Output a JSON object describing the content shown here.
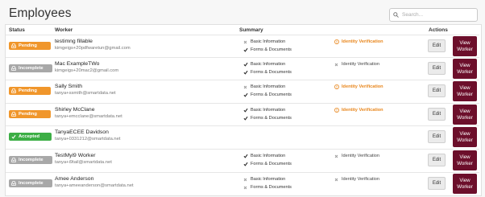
{
  "header": {
    "title": "Employees",
    "search_placeholder": "Search..."
  },
  "columns": {
    "status": "Status",
    "worker": "Worker",
    "summary": "Summary",
    "actions": "Actions"
  },
  "rows": [
    {
      "status": "Pending",
      "status_type": "pending",
      "name": "testimng fillable",
      "email": "kimgeigs+20pdfwaretun@gmail.com",
      "basic": {
        "label": "Basic Information",
        "done": false
      },
      "forms": {
        "label": "Forms & Documents",
        "done": true
      },
      "idv": {
        "label": "Identity Verification",
        "state": "warning"
      },
      "edit": "Edit",
      "view": "View Worker"
    },
    {
      "status": "Incomplete",
      "status_type": "incomplete",
      "name": "Mac ExampleTWo",
      "email": "kimgeigs+20mac2@gmail.com",
      "basic": {
        "label": "Basic Information",
        "done": true
      },
      "forms": {
        "label": "Forms & Documents",
        "done": true
      },
      "idv": {
        "label": "Identity Verification",
        "state": "incomplete"
      },
      "edit": "Edit",
      "view": "View Worker"
    },
    {
      "status": "Pending",
      "status_type": "pending",
      "name": "Sally Smith",
      "email": "tanya+ssmith@smartdata.net",
      "basic": {
        "label": "Basic Information",
        "done": false
      },
      "forms": {
        "label": "Forms & Documents",
        "done": true
      },
      "idv": {
        "label": "Identity Verification",
        "state": "warning"
      },
      "edit": "Edit",
      "view": "View Worker"
    },
    {
      "status": "Pending",
      "status_type": "pending",
      "name": "Shirley McClane",
      "email": "tanya+emcclane@smartdata.net",
      "basic": {
        "label": "Basic Information",
        "done": true
      },
      "forms": {
        "label": "Forms & Documents",
        "done": true
      },
      "idv": {
        "label": "Identity Verification",
        "state": "warning"
      },
      "edit": "Edit",
      "view": "View Worker"
    },
    {
      "status": "Accepted",
      "status_type": "accepted",
      "name": "TanyaECEE Davidson",
      "email": "tanya+0331212@smartdata.net",
      "basic": null,
      "forms": null,
      "idv": null,
      "edit": "Edit",
      "view": "View Worker"
    },
    {
      "status": "Incomplete",
      "status_type": "incomplete",
      "name": "TestMyi9 Worker",
      "email": "tanya+i9tail@smartdata.net",
      "basic": {
        "label": "Basic Information",
        "done": true
      },
      "forms": {
        "label": "Forms & Documents",
        "done": true
      },
      "idv": {
        "label": "Identity Verification",
        "state": "incomplete"
      },
      "edit": "Edit",
      "view": "View Worker"
    },
    {
      "status": "Incomplete",
      "status_type": "incomplete",
      "name": "Amee Anderson",
      "email": "tanya+ameeanderson@smartdata.net",
      "basic": {
        "label": "Basic Information",
        "done": false
      },
      "forms": {
        "label": "Forms & Documents",
        "done": false
      },
      "idv": {
        "label": "Identity Verification",
        "state": "incomplete"
      },
      "edit": "Edit",
      "view": "View Worker"
    }
  ],
  "colors": {
    "pending": "#f0962b",
    "incomplete": "#a8a8a8",
    "accepted": "#3cae45",
    "view_button": "#6c0f2b",
    "warning_text": "#e8861c"
  },
  "icons": {
    "pending": "inbox-icon",
    "incomplete": "inbox-icon",
    "accepted": "check-icon",
    "done": "check-icon",
    "not_done": "x-icon",
    "warning": "warning-icon",
    "search": "search-icon"
  }
}
